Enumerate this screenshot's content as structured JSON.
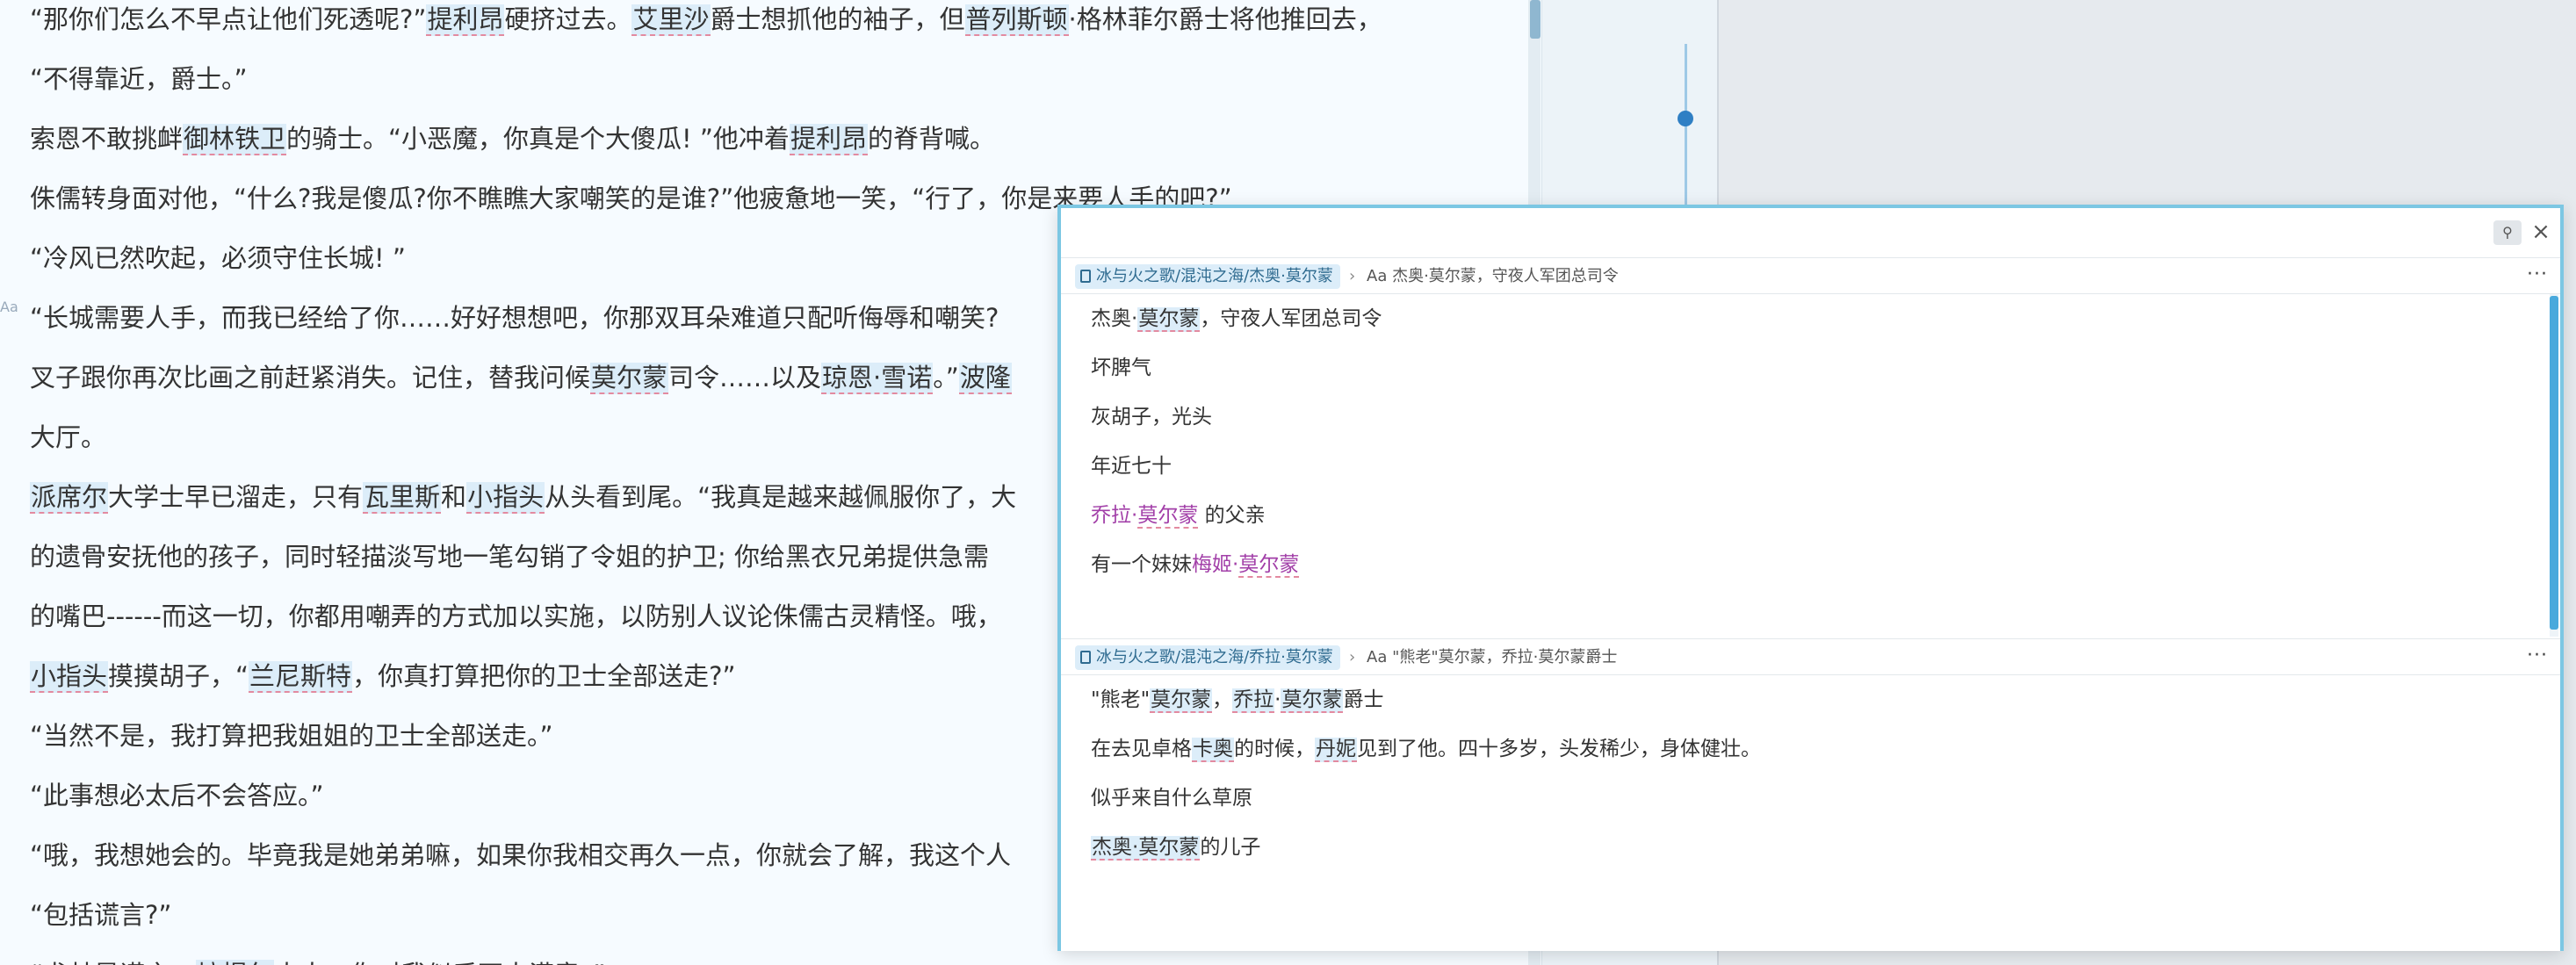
{
  "reader": {
    "paragraphs": [
      {
        "segments": [
          {
            "t": "“那你们怎么不早点让他们死透呢?”"
          },
          {
            "t": "提利昂",
            "link": true
          },
          {
            "t": "硬挤过去。"
          },
          {
            "t": "艾里沙",
            "link": true
          },
          {
            "t": "爵士想抓他的袖子，但"
          },
          {
            "t": "普列斯顿",
            "link": true
          },
          {
            "t": "·格林菲尔爵士将他推回去，"
          }
        ]
      },
      {
        "segments": [
          {
            "t": "“不得靠近，爵士。”"
          }
        ]
      },
      {
        "segments": [
          {
            "t": "索恩不敢挑衅"
          },
          {
            "t": "御林铁卫",
            "link": true
          },
          {
            "t": "的骑士。“小恶魔，你真是个大傻瓜! ”他冲着"
          },
          {
            "t": "提利昂",
            "link": true
          },
          {
            "t": "的脊背喊。"
          }
        ]
      },
      {
        "segments": [
          {
            "t": "侏儒转身面对他，“什么?我是傻瓜?你不瞧瞧大家嘲笑的是谁?”他疲惫地一笑，“行了，你是来要人手的吧?”"
          }
        ]
      },
      {
        "segments": [
          {
            "t": "“冷风已然吹起，必须守住长城! ”"
          }
        ]
      },
      {
        "segments": [
          {
            "t": "“长城需要人手，而我已经给了你……好好想想吧，你那双耳朵难道只配听侮辱和嘲笑?"
          }
        ]
      },
      {
        "segments": [
          {
            "t": "叉子跟你再次比画之前赶紧消失。记住，替我问候"
          },
          {
            "t": "莫尔蒙",
            "link": true
          },
          {
            "t": "司令……以及"
          },
          {
            "t": "琼恩·雪诺",
            "link": true
          },
          {
            "t": "。”"
          },
          {
            "t": "波隆",
            "link": true
          }
        ]
      },
      {
        "segments": [
          {
            "t": "大厅。"
          }
        ]
      },
      {
        "segments": [
          {
            "t": "派席尔",
            "link": true
          },
          {
            "t": "大学士早已溜走，只有"
          },
          {
            "t": "瓦里斯",
            "link": true
          },
          {
            "t": "和"
          },
          {
            "t": "小指头",
            "link": true
          },
          {
            "t": "从头看到尾。“我真是越来越佩服你了，大"
          }
        ]
      },
      {
        "segments": [
          {
            "t": "的遗骨安抚他的孩子，同时轻描淡写地一笔勾销了令姐的护卫; 你给黑衣兄弟提供急需"
          }
        ]
      },
      {
        "segments": [
          {
            "t": "的嘴巴------而这一切，你都用嘲弄的方式加以实施，以防别人议论侏儒古灵精怪。哦，"
          }
        ]
      },
      {
        "segments": [
          {
            "t": "小指头",
            "link": true
          },
          {
            "t": "摸摸胡子，“"
          },
          {
            "t": "兰尼斯特",
            "link": true
          },
          {
            "t": "，你真打算把你的卫士全部送走?”"
          }
        ]
      },
      {
        "segments": [
          {
            "t": "“当然不是，我打算把我姐姐的卫士全部送走。”"
          }
        ]
      },
      {
        "segments": [
          {
            "t": "“此事想必太后不会答应。”"
          }
        ]
      },
      {
        "segments": [
          {
            "t": "“哦，我想她会的。毕竟我是她弟弟嘛，如果你我相交再久一点，你就会了解，我这个人"
          }
        ]
      },
      {
        "segments": [
          {
            "t": "“包括谎言?”"
          }
        ]
      },
      {
        "segments": [
          {
            "t": "“尤其是谎言。"
          },
          {
            "t": "培提尔",
            "link": true
          },
          {
            "t": "大人，你对我似乎不太满意。”"
          }
        ]
      }
    ],
    "aa_badge": "Aa"
  },
  "popup": {
    "pin_icon": "pin-icon",
    "close_icon": "close-icon",
    "close_glyph": "×",
    "pin_glyph": "⚲",
    "sections": [
      {
        "path": "冰与火之歌/混沌之海/杰奥·莫尔蒙",
        "separator": "›",
        "heading": "Aa 杰奥·莫尔蒙，守夜人军团总司令",
        "more": "···",
        "lines": [
          {
            "segments": [
              {
                "t": "杰奥·"
              },
              {
                "t": "莫尔蒙",
                "link": true
              },
              {
                "t": "，守夜人军团总司令"
              }
            ]
          },
          {
            "segments": [
              {
                "t": "坏脾气"
              }
            ]
          },
          {
            "segments": [
              {
                "t": "灰胡子，光头"
              }
            ]
          },
          {
            "segments": [
              {
                "t": "年近七十"
              }
            ]
          },
          {
            "segments": [
              {
                "t": "乔拉·",
                "pink": true
              },
              {
                "t": "莫尔蒙",
                "pinklink": true
              },
              {
                "t": " 的父亲"
              }
            ]
          },
          {
            "segments": [
              {
                "t": "有一个妹妹"
              },
              {
                "t": "梅姬·",
                "pink": true
              },
              {
                "t": "莫尔蒙",
                "pinklink": true
              }
            ]
          }
        ]
      },
      {
        "path": "冰与火之歌/混沌之海/乔拉·莫尔蒙",
        "separator": "›",
        "heading": "Aa \"熊老\"莫尔蒙，乔拉·莫尔蒙爵士",
        "more": "···",
        "lines": [
          {
            "segments": [
              {
                "t": "\"熊老\""
              },
              {
                "t": "莫尔蒙",
                "link": true
              },
              {
                "t": "，"
              },
              {
                "t": "乔拉",
                "link": true
              },
              {
                "t": "·"
              },
              {
                "t": "莫尔蒙",
                "link": true
              },
              {
                "t": "爵士"
              }
            ]
          },
          {
            "segments": [
              {
                "t": "在去见卓格"
              },
              {
                "t": "卡奥",
                "link": true
              },
              {
                "t": "的时候，"
              },
              {
                "t": "丹妮",
                "link": true
              },
              {
                "t": "见到了他。四十多岁，头发稀少，身体健壮。"
              }
            ]
          },
          {
            "segments": [
              {
                "t": "似乎来自什么草原"
              }
            ]
          },
          {
            "segments": [
              {
                "t": "杰奥·莫尔蒙",
                "link": true
              },
              {
                "t": "的儿子"
              }
            ]
          }
        ]
      }
    ]
  }
}
